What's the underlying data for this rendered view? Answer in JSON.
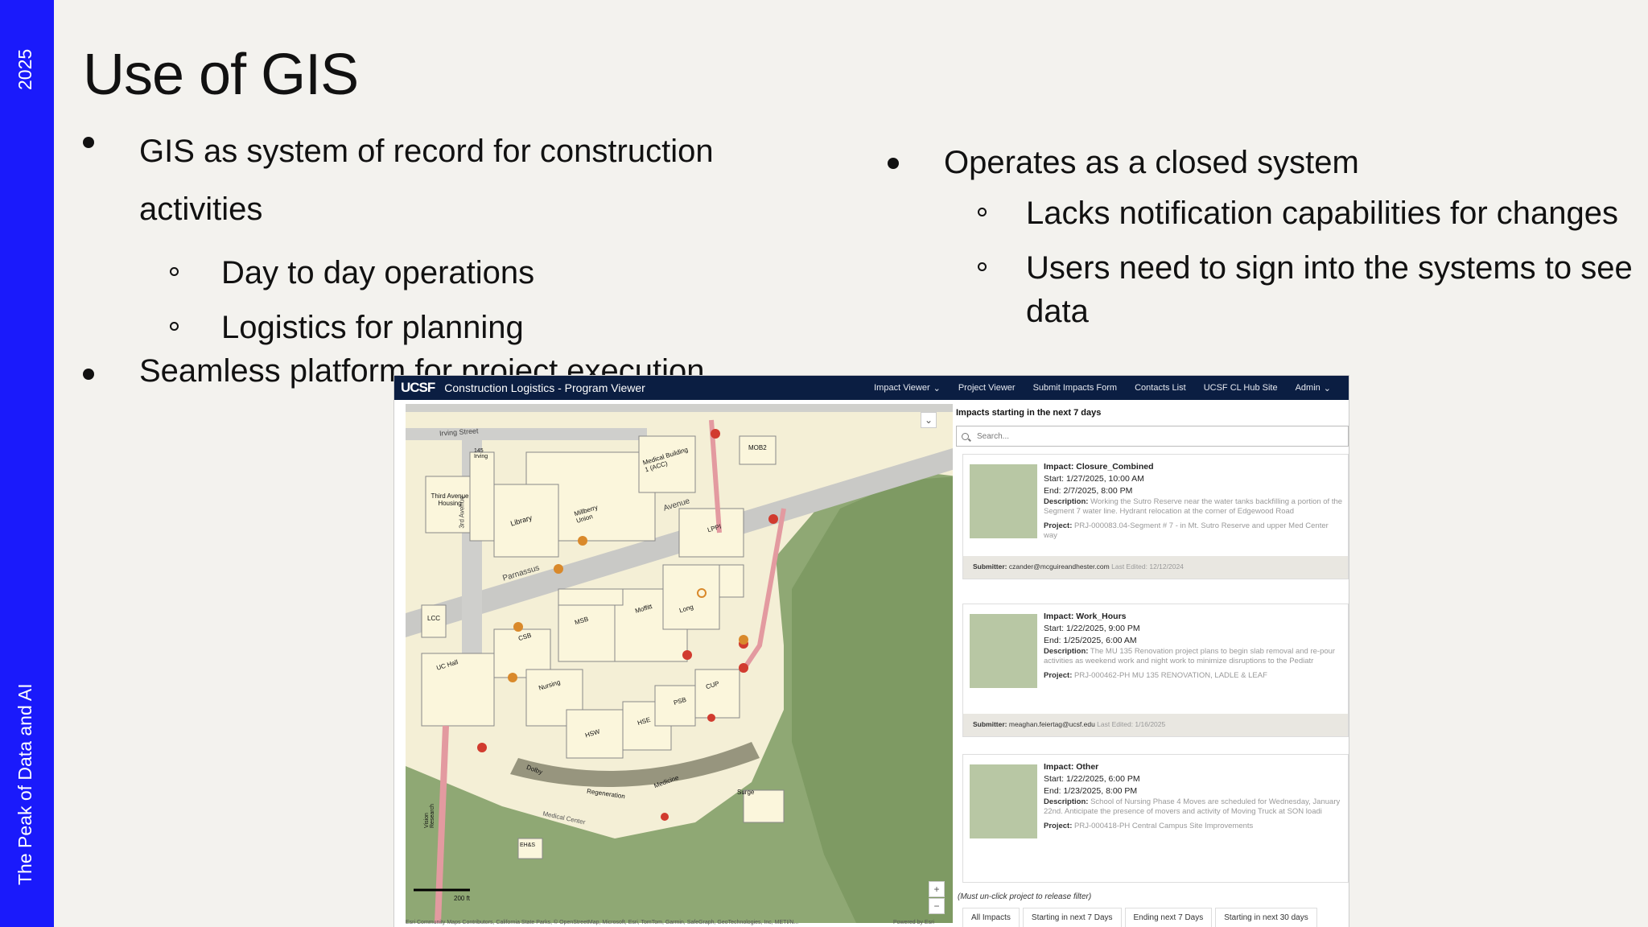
{
  "band": {
    "year": "2025",
    "tagline": "The Peak of Data and AI",
    "color": "#1a1afb"
  },
  "slide": {
    "title": "Use of GIS",
    "left_bullets": {
      "b1_line1": "GIS as system of record for construction",
      "b1_line2": "activities",
      "sub1": "Day to day operations",
      "sub2": "Logistics for planning",
      "b2": "Seamless platform for project execution"
    },
    "right_bullets": {
      "b1": "Operates as a closed system",
      "sub1": "Lacks notification capabilities for changes",
      "sub2_line1": "Users need to sign into the systems to see",
      "sub2_line2": "data"
    }
  },
  "app": {
    "logo": "UCSF",
    "title": "Construction Logistics - Program Viewer",
    "nav": [
      "Impact Viewer",
      "Project Viewer",
      "Submit Impacts Form",
      "Contacts List",
      "UCSF CL Hub Site",
      "Admin"
    ],
    "panel_heading": "Impacts starting in the next 7 days",
    "search_placeholder": "Search...",
    "cards": [
      {
        "impact": "Impact: Closure_Combined",
        "start": "Start: 1/27/2025, 10:00 AM",
        "end": "End: 2/7/2025, 8:00 PM",
        "desc_label": "Description:",
        "desc": "Working the Sutro Reserve near the water tanks backfilling a portion of the Segment 7 water line. Hydrant relocation at the corner of Edgewood Road",
        "proj_label": "Project:",
        "proj": "PRJ-000083.04-Segment # 7 - in Mt. Sutro Reserve and upper Med Center way",
        "sub_label": "Submitter:",
        "submitter": "czander@mcguireandhester.com",
        "edited": "Last Edited: 12/12/2024"
      },
      {
        "impact": "Impact: Work_Hours",
        "start": "Start: 1/22/2025, 9:00 PM",
        "end": "End: 1/25/2025, 6:00 AM",
        "desc_label": "Description:",
        "desc": "The MU 135 Renovation project plans to begin slab removal and re-pour activities as weekend work and night work to minimize disruptions to the Pediatr",
        "proj_label": "Project:",
        "proj": "PRJ-000462-PH MU 135 RENOVATION, LADLE & LEAF",
        "sub_label": "Submitter:",
        "submitter": "meaghan.feiertag@ucsf.edu",
        "edited": "Last Edited: 1/16/2025"
      },
      {
        "impact": "Impact: Other",
        "start": "Start: 1/22/2025, 6:00 PM",
        "end": "End: 1/23/2025, 8:00 PM",
        "desc_label": "Description:",
        "desc": "School of Nursing Phase 4 Moves are scheduled for Wednesday, January 22nd. Anticipate the presence of movers and activity of Moving Truck at SON loadi",
        "proj_label": "Project:",
        "proj": "PRJ-000418-PH Central Campus Site Improvements"
      }
    ],
    "release_note": "(Must un-click project to release filter)",
    "tabs": [
      "All Impacts",
      "Starting in next 7 Days",
      "Ending next 7 Days",
      "Starting in next 30 days"
    ],
    "attribution": "Esri Community Maps Contributors, California State Parks, © OpenStreetMap, Microsoft, Esri, TomTom, Garmin, SafeGraph, GeoTechnologies, Inc, METI/N...",
    "powered": "Powered by Esri",
    "scale": "200 ft",
    "map_labels": {
      "street1": "Irving Street",
      "street2": "Parnassus",
      "street3": "Avenue",
      "street4": "3rd Avenue",
      "b1": "145 Irving",
      "b2": "Third Avenue Housing",
      "b3": "Library",
      "b4": "Millberry Union",
      "b5": "Medical Building 1 (ACC)",
      "b6": "MOB2",
      "b7": "LPPI",
      "b8": "LCC",
      "b9": "CSB",
      "b10": "MSB",
      "b11": "Moffitt",
      "b12": "Long",
      "b13": "UC Hall",
      "b14": "Nursing",
      "b15": "HSW",
      "b16": "HSE",
      "b17": "PSB",
      "b18": "CUP",
      "b19": "Dolby",
      "b20": "Regeneration",
      "b21": "Medicine",
      "b22": "EH&S",
      "b23": "Vision Research",
      "b24": "Surge",
      "b25": "Medical Center"
    }
  }
}
